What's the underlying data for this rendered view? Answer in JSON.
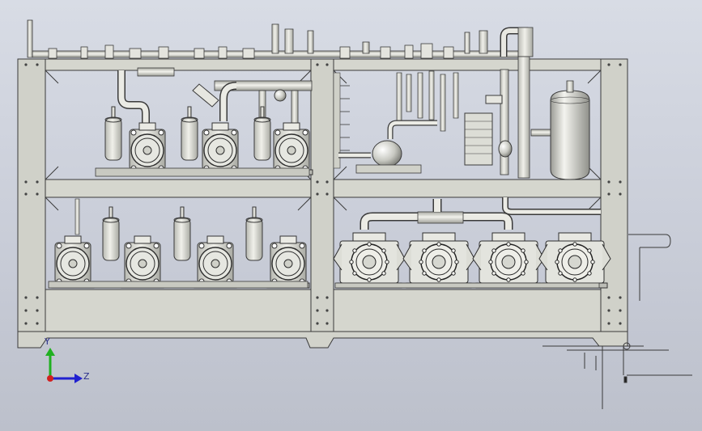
{
  "viewport": {
    "background_top": "#d8dce5",
    "background_bottom": "#bcc0cb"
  },
  "model": {
    "frame_color": "#cfd0c8",
    "edge_color": "#3a3a3a",
    "component_color": "#d7d8d2",
    "upper_left_compressors": 3,
    "lower_left_compressors": 4,
    "lower_right_compressors": 4,
    "receiver_tank_icon": "vertical-receiver-tank"
  },
  "triad": {
    "y_label": "Y",
    "z_label": "Z",
    "x_axis_color": "#d22020",
    "y_axis_color": "#20b020",
    "z_axis_color": "#2020d0"
  }
}
